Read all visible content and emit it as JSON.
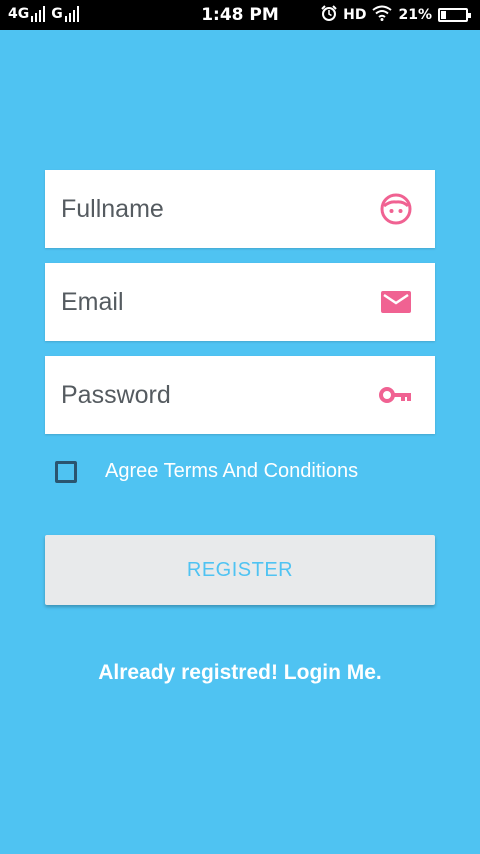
{
  "status_bar": {
    "network_left": "4G",
    "network_right": "G",
    "time": "1:48 PM",
    "hd": "HD",
    "battery_percent": "21%",
    "battery_level": 0.21,
    "icons": [
      "signal-icon",
      "alarm-icon",
      "wifi-icon",
      "battery-icon"
    ]
  },
  "form": {
    "fullname": {
      "placeholder": "Fullname",
      "value": "",
      "icon": "face-icon"
    },
    "email": {
      "placeholder": "Email",
      "value": "",
      "icon": "mail-icon"
    },
    "password": {
      "placeholder": "Password",
      "value": "",
      "icon": "key-icon"
    },
    "agree_label": "Agree Terms And Conditions",
    "agree_checked": false,
    "register_label": "REGISTER",
    "login_link": "Already registred! Login Me."
  },
  "colors": {
    "background": "#4fc3f2",
    "icon_accent": "#f06292",
    "button_bg": "#e8eaeb",
    "button_text": "#4fc3f2"
  }
}
